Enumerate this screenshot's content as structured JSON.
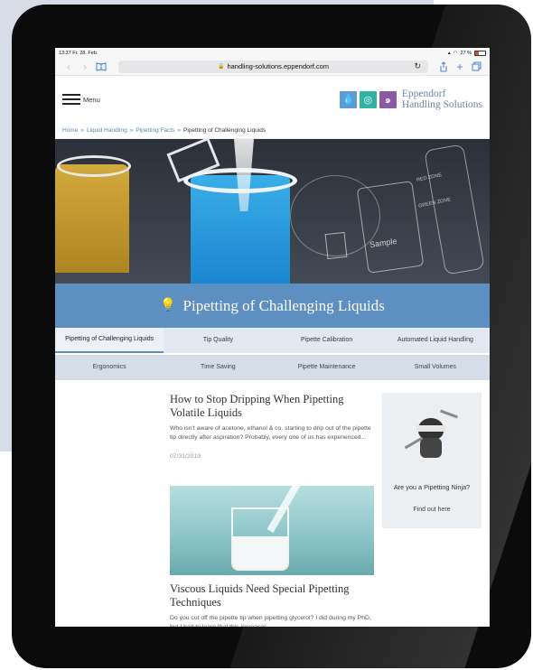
{
  "statusbar": {
    "time": "13:37",
    "date": "Fr. 28. Feb.",
    "battery": "27 %"
  },
  "browser": {
    "url": "handling-solutions.eppendorf.com",
    "back_icon": "chevron-left-icon",
    "forward_icon": "chevron-right-icon",
    "bookmarks_icon": "book-icon",
    "reload_icon": "reload-icon",
    "share_icon": "share-icon",
    "new_tab_icon": "plus-icon",
    "tabs_icon": "tabs-icon"
  },
  "header": {
    "menu_label": "Menu",
    "brand_line1": "Eppendorf",
    "brand_line2": "Handling Solutions",
    "brand_colors": [
      "#5d9bd3",
      "#31b3a4",
      "#8b5aa7"
    ]
  },
  "breadcrumb": {
    "items": [
      "Home",
      "Liquid Handling",
      "Pipetting Facts"
    ],
    "separator": "»",
    "current": "Pipetting of Challenging Liquids"
  },
  "hero": {
    "title": "Pipetting of Challenging Liquids",
    "sample_label": "Sample",
    "red_zone": "RED ZONE",
    "green_zone": "GREEN ZONE"
  },
  "tabs": {
    "row1": [
      "Pipetting of Challenging Liquids",
      "Tip Quality",
      "Pipette Calibration",
      "Automated Liquid Handling"
    ],
    "row2": [
      "Ergonomics",
      "Time Saving",
      "Pipette Maintenance",
      "Small Volumes"
    ]
  },
  "articles": [
    {
      "title": "How to Stop Dripping When Pipetting Volatile Liquids",
      "excerpt": "Who isn't aware of acetone, ethanol & co. starting to drip out of the pipette tip directly after aspiration? Probably, every one of us has experienced...",
      "date": "07/31/2019"
    },
    {
      "title": "Viscous Liquids Need Special Pipetting Techniques",
      "excerpt": "Do you cut off the pipette tip when pipetting glycerol? I did during my PhD, but I had to learn that this increases..."
    }
  ],
  "sidebar": {
    "question": "Are you a Pipetting Ninja?",
    "link": "Find out here"
  },
  "colors": {
    "accent": "#5d8fc1",
    "link": "#5a86b9",
    "tab_bg": "#e2e9f1"
  }
}
